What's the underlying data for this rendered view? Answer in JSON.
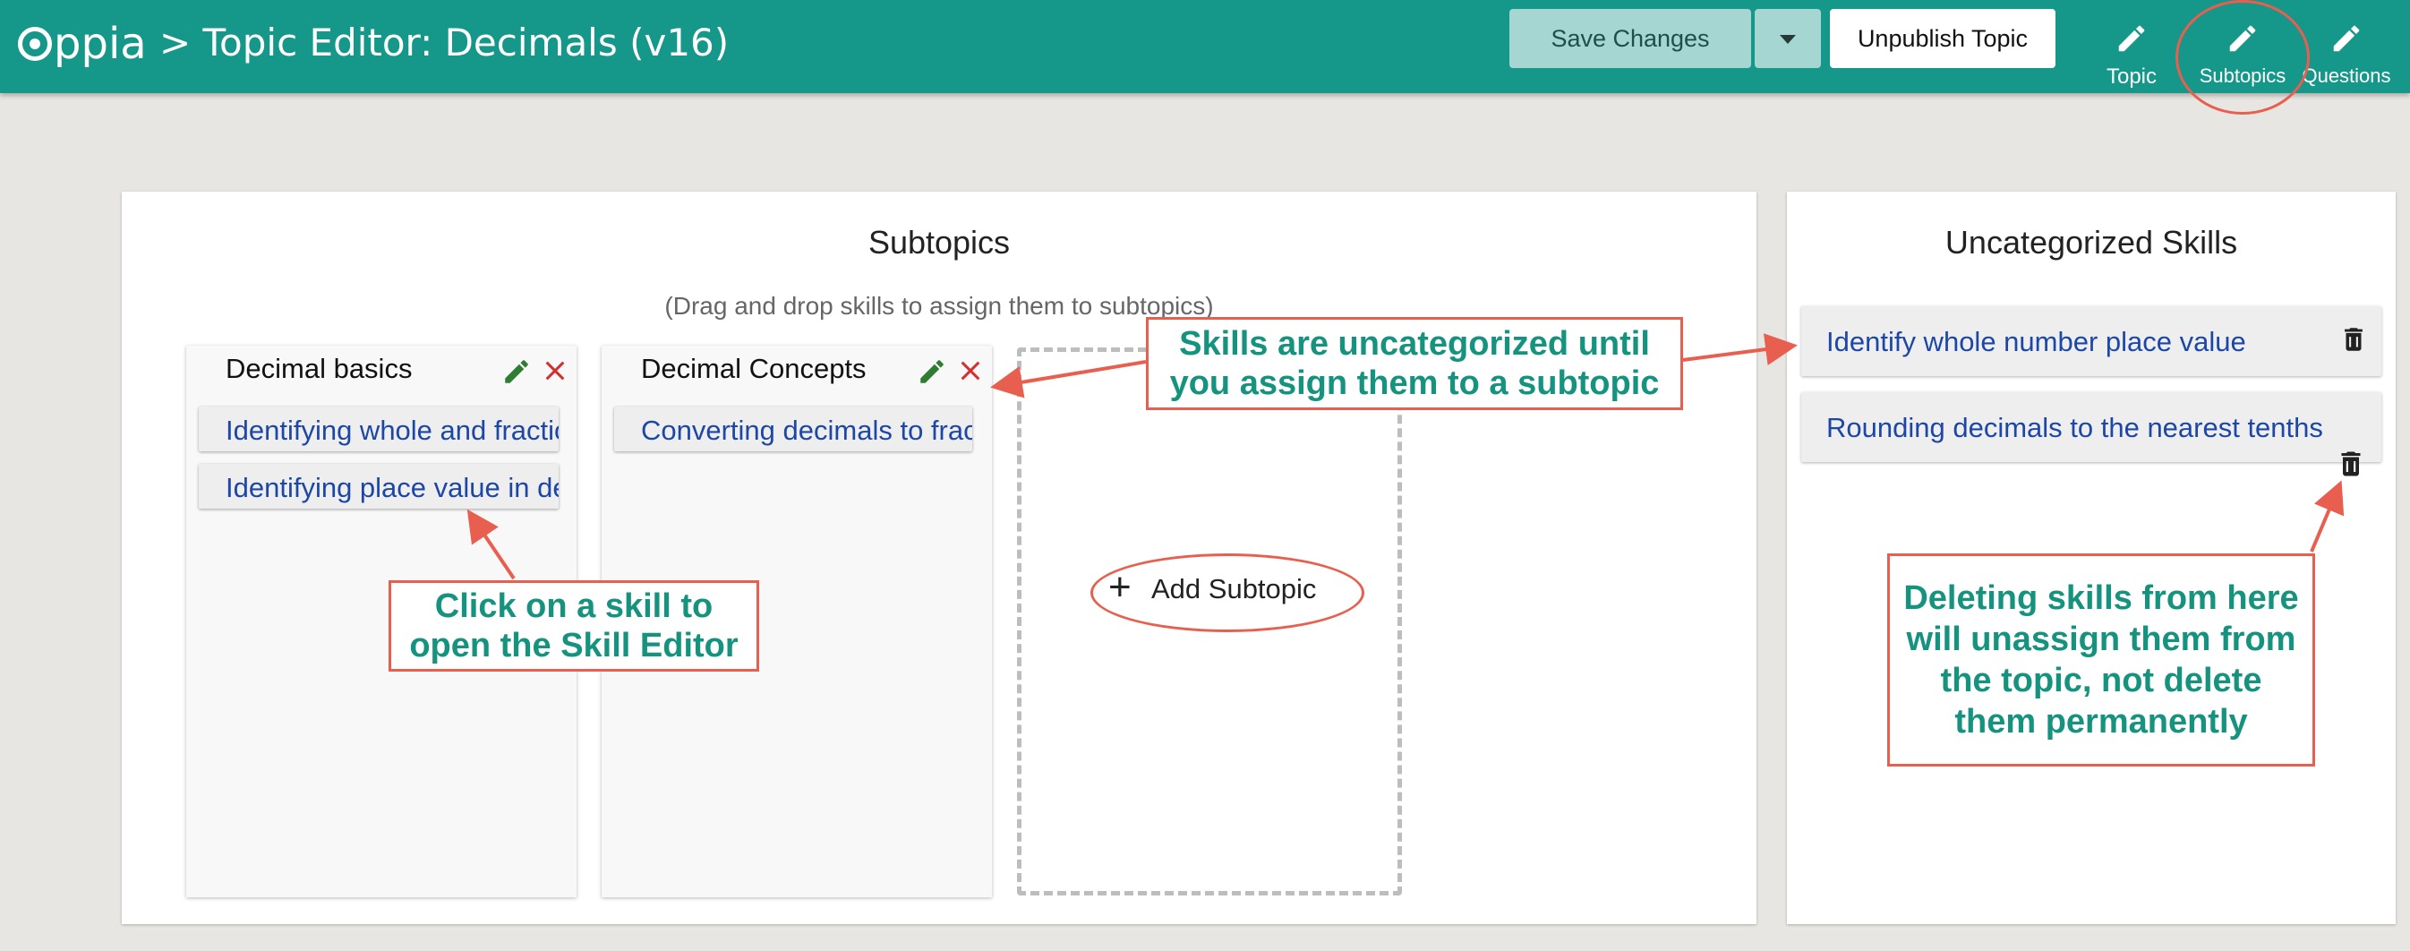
{
  "header": {
    "logo_text": "ppia",
    "title": "> Topic Editor: Decimals (v16)",
    "save_label": "Save Changes",
    "unpublish_label": "Unpublish Topic",
    "tabs": [
      {
        "label": "Topic",
        "icon": "pencil-icon"
      },
      {
        "label": "Subtopics",
        "icon": "pencil-icon"
      },
      {
        "label": "Questions",
        "icon": "pencil-icon"
      }
    ]
  },
  "subtopics_card": {
    "title": "Subtopics",
    "subtitle": "(Drag and drop skills to assign them to subtopics)",
    "columns": [
      {
        "name": "Decimal basics",
        "skills": [
          "Identifying whole and fractional parts of decimals",
          "Identifying place value in decimals"
        ]
      },
      {
        "name": "Decimal Concepts",
        "skills": [
          "Converting decimals to fractions"
        ]
      }
    ],
    "add_label": "Add Subtopic"
  },
  "uncategorized_card": {
    "title": "Uncategorized Skills",
    "skills": [
      "Identify whole number place value",
      "Rounding decimals to the nearest tenths"
    ]
  },
  "annotations": {
    "skill_editor": "Click on a skill to\nopen the Skill Editor",
    "uncategorized": "Skills are uncategorized until\nyou assign them to a subtopic",
    "deleting": "Deleting skills from here\nwill unassign them from\nthe topic, not delete\nthem permanently"
  },
  "colors": {
    "header": "#15978a",
    "skill_link": "#1d47a6",
    "edit_icon": "#2e7d32",
    "delete_icon": "#d32f2f",
    "annotation_text": "#16937f",
    "annotation_border": "#e95f4f"
  }
}
